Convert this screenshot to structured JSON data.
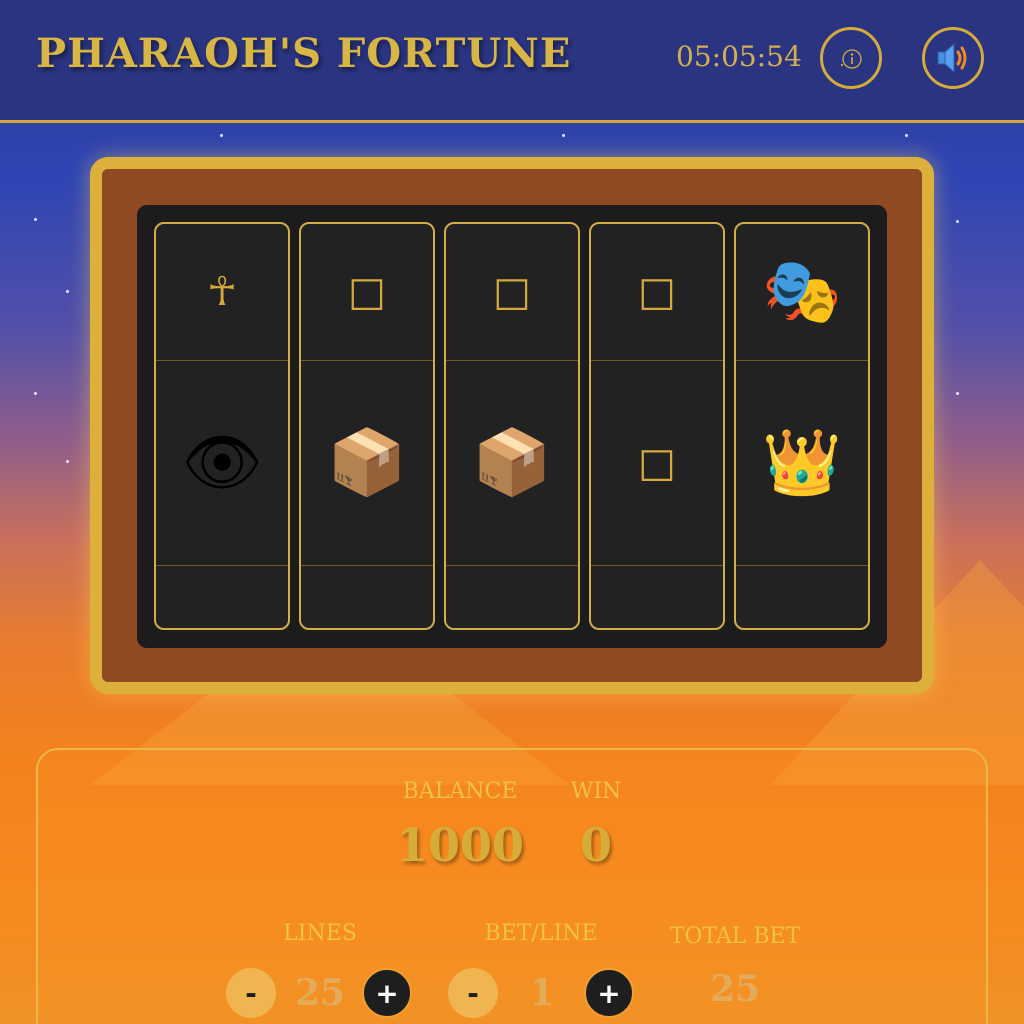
{
  "header": {
    "title": "PHARAOH'S FORTUNE",
    "clock": "05:05:54",
    "info_icon": "info-icon",
    "sound_icon": "speaker-volume-icon"
  },
  "colors": {
    "gold": "#d4aa3c",
    "header_bg": "#2a3480",
    "frame_bg": "#8f4a22",
    "reel_bg": "#222222"
  },
  "reels": [
    {
      "top": {
        "symbol": "ankh",
        "glyph": "☥"
      },
      "middle": {
        "symbol": "eye",
        "glyph": "👁"
      }
    },
    {
      "top": {
        "symbol": "missing-glyph",
        "glyph": "□"
      },
      "middle": {
        "symbol": "package",
        "glyph": "📦"
      }
    },
    {
      "top": {
        "symbol": "missing-glyph",
        "glyph": "□"
      },
      "middle": {
        "symbol": "package",
        "glyph": "📦"
      }
    },
    {
      "top": {
        "symbol": "missing-glyph",
        "glyph": "□"
      },
      "middle": {
        "symbol": "missing-glyph",
        "glyph": "□"
      }
    },
    {
      "top": {
        "symbol": "theater-masks",
        "glyph": "🎭"
      },
      "middle": {
        "symbol": "crown",
        "glyph": "👑"
      }
    }
  ],
  "stats": {
    "balance_label": "BALANCE",
    "balance_value": "1000",
    "win_label": "WIN",
    "win_value": "0"
  },
  "controls": {
    "lines_label": "LINES",
    "lines_value": "25",
    "bet_line_label": "BET/LINE",
    "bet_line_value": "1",
    "total_bet_label": "TOTAL BET",
    "total_bet_value": "25",
    "minus_label": "-",
    "plus_label": "+"
  }
}
